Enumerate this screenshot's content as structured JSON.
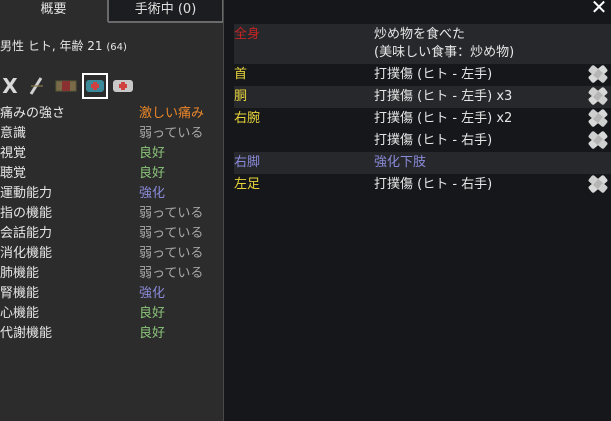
{
  "tabs": [
    {
      "label": "概要",
      "active": true
    },
    {
      "label": "手術中 (0)",
      "active": false
    }
  ],
  "gender_age": {
    "text": "男性 ヒト, 年齢 21",
    "detail": "(64)"
  },
  "icons": [
    "x-icon",
    "slash-icon",
    "bar-icon",
    "medicine-selected-icon",
    "medicine-icon"
  ],
  "stats": [
    {
      "label": "痛みの強さ",
      "value": "激しい痛み",
      "color": "#e8862a"
    },
    {
      "label": "意識",
      "value": "弱っている",
      "color": "#a8a8a8"
    },
    {
      "label": "視覚",
      "value": "良好",
      "color": "#8bc37a"
    },
    {
      "label": "聴覚",
      "value": "良好",
      "color": "#8bc37a"
    },
    {
      "label": "運動能力",
      "value": "強化",
      "color": "#8a8ad8"
    },
    {
      "label": "指の機能",
      "value": "弱っている",
      "color": "#a8a8a8"
    },
    {
      "label": "会話能力",
      "value": "弱っている",
      "color": "#a8a8a8"
    },
    {
      "label": "消化機能",
      "value": "弱っている",
      "color": "#a8a8a8"
    },
    {
      "label": "肺機能",
      "value": "弱っている",
      "color": "#a8a8a8"
    },
    {
      "label": "腎機能",
      "value": "強化",
      "color": "#8a8ad8"
    },
    {
      "label": "心機能",
      "value": "良好",
      "color": "#8bc37a"
    },
    {
      "label": "代謝機能",
      "value": "良好",
      "color": "#8bc37a"
    }
  ],
  "health": [
    {
      "part": "全身",
      "part_color": "#c42424",
      "desc": "炒め物を食べた\n(美味しい食事：炒め物)",
      "desc_color": "#e6e6e6",
      "bandage": false,
      "shade": true
    },
    {
      "part": "首",
      "part_color": "#e8d43a",
      "desc": "打撲傷 (ヒト - 左手)",
      "desc_color": "#e6e6e6",
      "bandage": true,
      "shade": false
    },
    {
      "part": "胴",
      "part_color": "#e8d43a",
      "desc": "打撲傷 (ヒト - 左手) x3",
      "desc_color": "#e6e6e6",
      "bandage": true,
      "shade": true
    },
    {
      "part": "右腕",
      "part_color": "#e8d43a",
      "desc": "打撲傷 (ヒト - 左手) x2",
      "desc_color": "#e6e6e6",
      "bandage": true,
      "shade": false
    },
    {
      "part": "",
      "part_color": "#e8d43a",
      "desc": "打撲傷 (ヒト - 右手)",
      "desc_color": "#e6e6e6",
      "bandage": true,
      "shade": false
    },
    {
      "part": "右脚",
      "part_color": "#8a8ad8",
      "desc": "強化下肢",
      "desc_color": "#8a8ad8",
      "bandage": false,
      "shade": true
    },
    {
      "part": "左足",
      "part_color": "#e8d43a",
      "desc": "打撲傷 (ヒト - 右手)",
      "desc_color": "#e6e6e6",
      "bandage": true,
      "shade": false
    }
  ]
}
